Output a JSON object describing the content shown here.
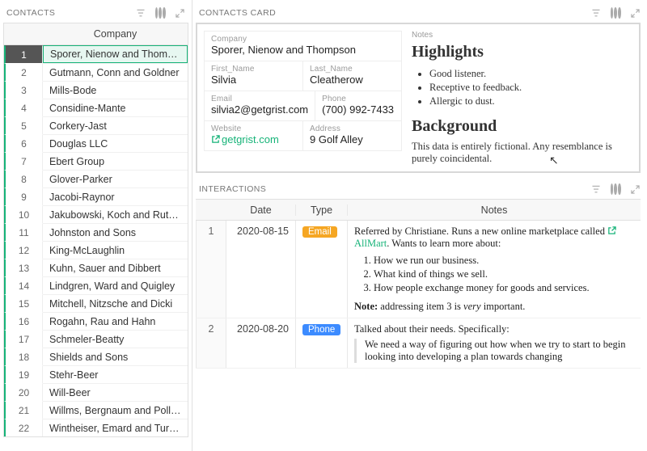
{
  "contacts_section_title": "CONTACTS",
  "contacts_card_section_title": "CONTACTS Card",
  "interactions_section_title": "INTERACTIONS",
  "contacts": {
    "header_company": "Company",
    "rows": [
      "Sporer, Nienow and Thom…",
      "Gutmann, Conn and Goldner",
      "Mills-Bode",
      "Considine-Mante",
      "Corkery-Jast",
      "Douglas LLC",
      "Ebert Group",
      "Glover-Parker",
      "Jacobi-Raynor",
      "Jakubowski, Koch and Rut…",
      "Johnston and Sons",
      "King-McLaughlin",
      "Kuhn, Sauer and Dibbert",
      "Lindgren, Ward and Quigley",
      "Mitchell, Nitzsche and Dicki",
      "Rogahn, Rau and Hahn",
      "Schmeler-Beatty",
      "Shields and Sons",
      "Stehr-Beer",
      "Will-Beer",
      "Willms, Bergnaum and Poll…",
      "Wintheiser, Emard and Tur…"
    ]
  },
  "card": {
    "company_label": "Company",
    "company_value": "Sporer, Nienow and Thompson",
    "first_name_label": "First_Name",
    "first_name_value": "Silvia",
    "last_name_label": "Last_Name",
    "last_name_value": "Cleatherow",
    "email_label": "Email",
    "email_value": "silvia2@getgrist.com",
    "phone_label": "Phone",
    "phone_value": "(700) 992-7433",
    "website_label": "Website",
    "website_value": "getgrist.com",
    "address_label": "Address",
    "address_value": "9 Golf Alley",
    "notes_label": "Notes",
    "highlights_heading": "Highlights",
    "highlights": [
      "Good listener.",
      "Receptive to feedback.",
      "Allergic to dust."
    ],
    "background_heading": "Background",
    "background_text": "This data is entirely fictional. Any resemblance is purely coincidental."
  },
  "interactions": {
    "header_date": "Date",
    "header_type": "Type",
    "header_notes": "Notes",
    "rows": [
      {
        "idx": "1",
        "date": "2020-08-15",
        "type": "Email",
        "type_class": "email",
        "intro_prefix": "Referred by Christiane. Runs a new online marketplace called ",
        "link_text": "AllMart",
        "intro_suffix": ". Wants to learn more about:",
        "items": [
          "How we run our business.",
          "What kind of things we sell.",
          "How people exchange money for goods and services."
        ],
        "note_label": "Note:",
        "note_text_before": " addressing item 3 is ",
        "note_emph": "very",
        "note_text_after": " important."
      },
      {
        "idx": "2",
        "date": "2020-08-20",
        "type": "Phone",
        "type_class": "phone",
        "lead": "Talked about their needs. Specifically:",
        "quote": "We need a way of figuring out how when we try to start to begin looking into developing a plan towards changing"
      }
    ]
  }
}
